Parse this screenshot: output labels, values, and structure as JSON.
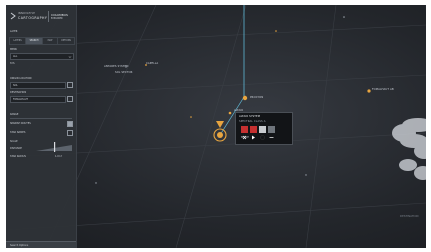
{
  "app": {
    "logo_line1": "INNOVATIVE",
    "logo_line2": "CARTOGRAPHY",
    "title": "COLUMBUS",
    "subtitle": "EXPLORER"
  },
  "sidebar": {
    "header": "LAYER",
    "tabs": [
      "LAYERS",
      "SEARCH",
      "MAP",
      "OPTIONS"
    ],
    "active_tab": 1,
    "section_label": "MENU",
    "select_value": "ALL",
    "system_label": "SYS",
    "origin_label": "ORIGIN LOCATION",
    "origin_value": "SOL",
    "dest_label": "DESTINATION",
    "dest_value": "FOMALHAUT",
    "range_label": "RANGE",
    "option1_label": "SPANISH ROUTES",
    "option1_checked": true,
    "option2_label": "STAR NAMES",
    "option2_checked": false,
    "scale_label": "SCALE",
    "dist_label": "DISTANCE",
    "size_label": "STAR RADIUS",
    "size_value": "1.0 LY",
    "footer_label": "Search Options"
  },
  "viewport": {
    "label_a": "ANTARES SYSTEM",
    "label_a2": "CAPELLA",
    "label_b": "SOL SECTOR",
    "label_c": "PROCYON",
    "label_d": "ALTAIR",
    "label_right": "FOMALHAUT AB",
    "label_bottom_right": "DESTINATION"
  },
  "popup": {
    "title": "ALTAIR SYSTEM",
    "subtitle": "SPECTRAL CLASS A",
    "action_label": "MOVE"
  },
  "colors": {
    "accent": "#e8a540",
    "route": "#5fb8d6",
    "danger": "#c53030"
  }
}
